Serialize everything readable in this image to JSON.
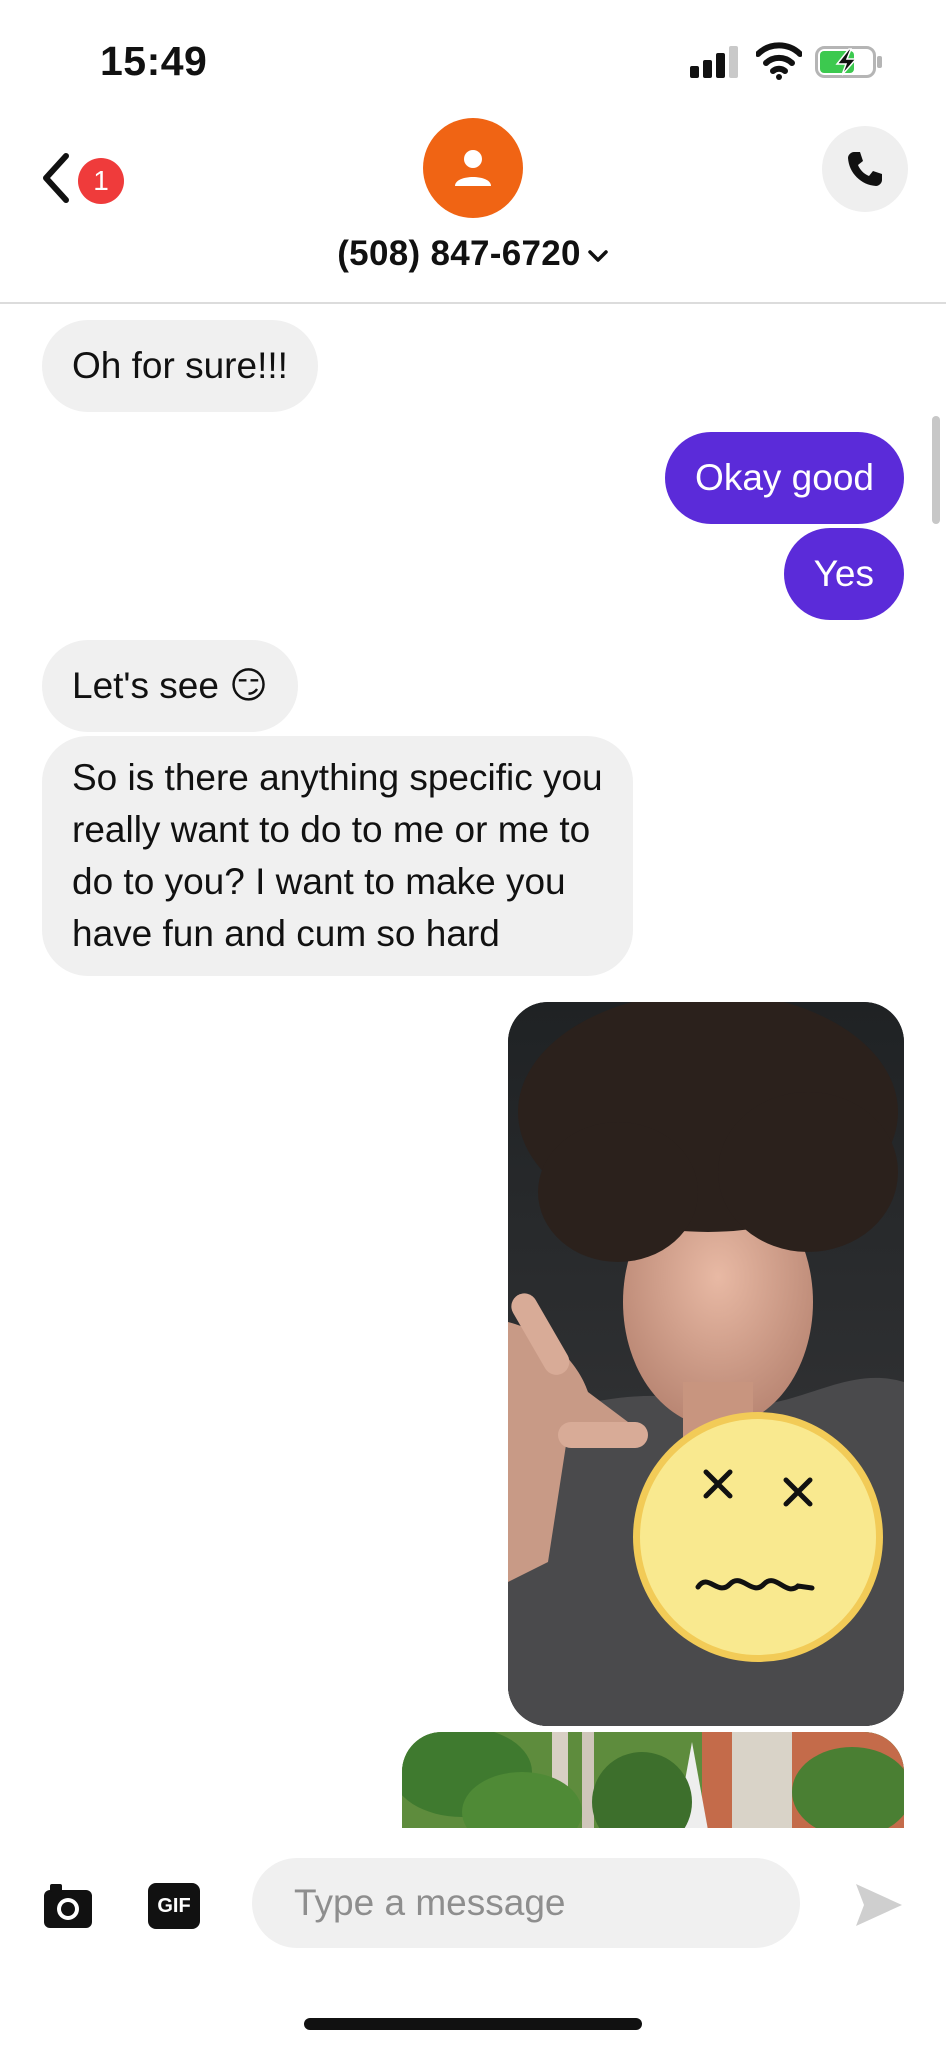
{
  "status_bar": {
    "time": "15:49"
  },
  "header": {
    "unread_count": "1",
    "contact_name": "(508) 847-6720",
    "avatar_color": "#f06414"
  },
  "messages": [
    {
      "direction": "incoming",
      "text": "Oh for sure!!!"
    },
    {
      "direction": "outgoing",
      "text": "Okay good"
    },
    {
      "direction": "outgoing",
      "text": "Yes"
    },
    {
      "direction": "incoming",
      "text": "Let's see 😏"
    },
    {
      "direction": "incoming",
      "lines": [
        "So is there anything specific you",
        "really want to do to me or me to",
        "do to you?  I want to make you",
        "have fun and cum so hard"
      ]
    },
    {
      "direction": "outgoing",
      "type": "photo"
    },
    {
      "direction": "outgoing",
      "type": "photo"
    }
  ],
  "composer": {
    "placeholder": "Type a message",
    "gif_label": "GIF"
  },
  "colors": {
    "outgoing_bubble": "#5b2bd9",
    "incoming_bubble": "#f0f0f0",
    "badge": "#ef3b3b"
  }
}
